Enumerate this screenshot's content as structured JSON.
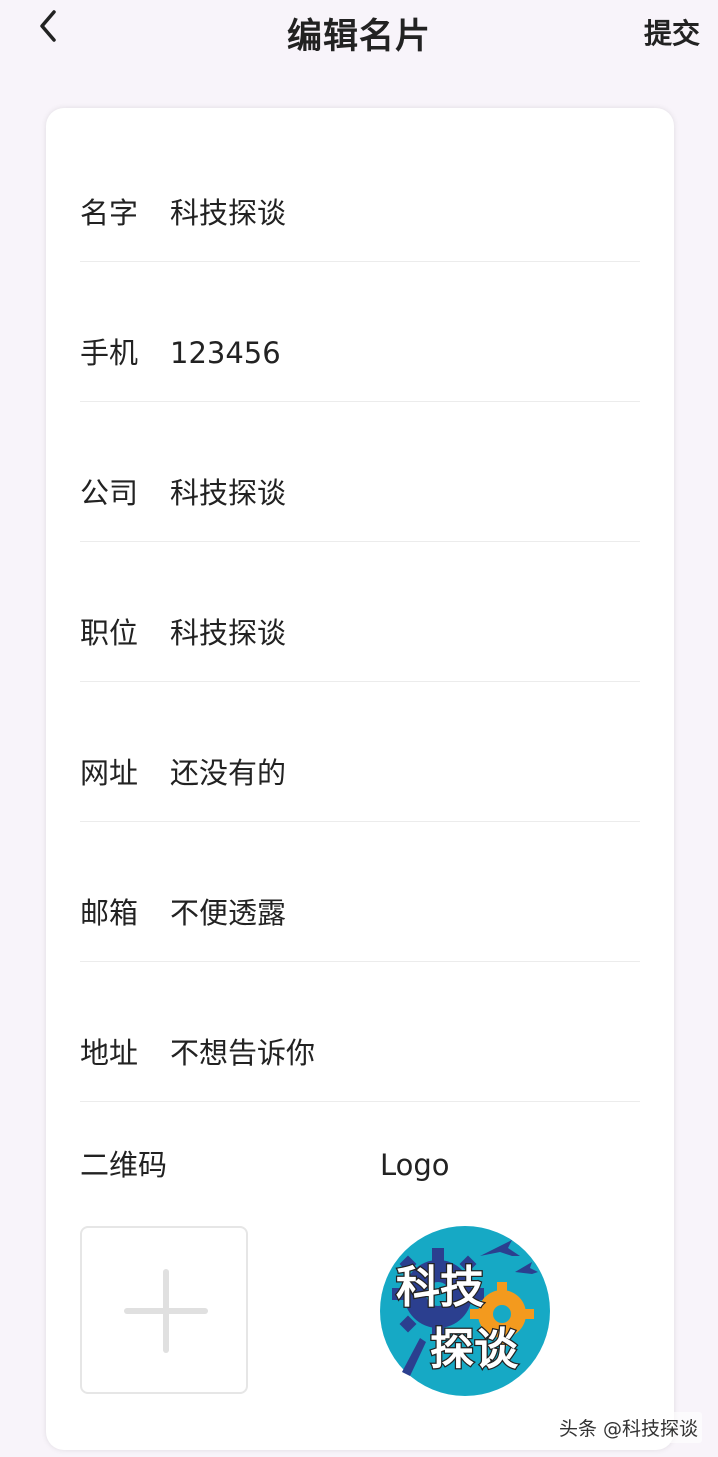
{
  "header": {
    "title": "编辑名片",
    "submit_label": "提交"
  },
  "fields": [
    {
      "label": "名字",
      "value": "科技探谈"
    },
    {
      "label": "手机",
      "value": "123456"
    },
    {
      "label": "公司",
      "value": "科技探谈"
    },
    {
      "label": "职位",
      "value": "科技探谈"
    },
    {
      "label": "网址",
      "value": "还没有的"
    },
    {
      "label": "邮箱",
      "value": "不便透露"
    },
    {
      "label": "地址",
      "value": "不想告诉你"
    }
  ],
  "uploads": {
    "qr_label": "二维码",
    "logo_label": "Logo",
    "logo_text_line1": "科技",
    "logo_text_line2": "探谈"
  },
  "watermark": "头条 @科技探谈",
  "colors": {
    "background": "#f8f4fa",
    "card": "#ffffff",
    "logo_circle": "#16a9c5",
    "logo_gear_blue": "#2b3f8f",
    "logo_gear_orange": "#f39a1e"
  }
}
